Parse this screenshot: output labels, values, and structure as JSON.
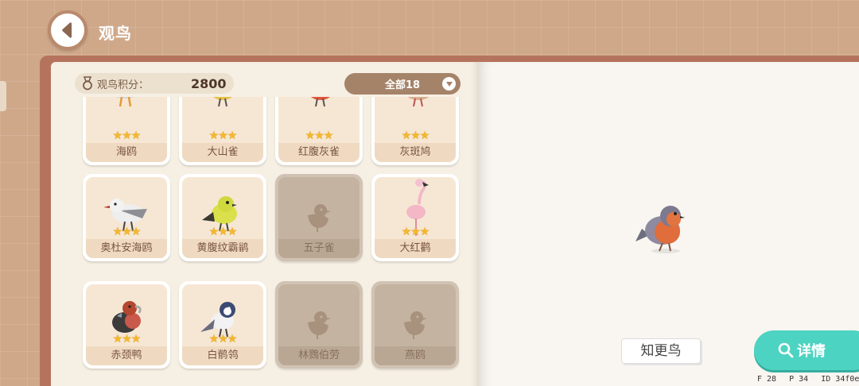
{
  "header": {
    "title": "观鸟"
  },
  "score": {
    "label": "观鸟积分：",
    "value": "2800"
  },
  "filter": {
    "label": "全部18"
  },
  "stars": "★★★",
  "birds": [
    {
      "name": "海鸥",
      "locked": false
    },
    {
      "name": "大山雀",
      "locked": false
    },
    {
      "name": "红腹灰雀",
      "locked": false
    },
    {
      "name": "灰斑鸠",
      "locked": false
    },
    {
      "name": "奥杜安海鸥",
      "locked": false
    },
    {
      "name": "黄腹纹霸鹟",
      "locked": false
    },
    {
      "name": "五子雀",
      "locked": true
    },
    {
      "name": "大红鹳",
      "locked": false
    },
    {
      "name": "赤颈鸭",
      "locked": false
    },
    {
      "name": "白鹡鸰",
      "locked": false
    },
    {
      "name": "林鷚伯劳",
      "locked": true
    },
    {
      "name": "燕鸥",
      "locked": true
    }
  ],
  "detail": {
    "learn_more": "知更鸟",
    "details_button": "详情"
  },
  "debug": {
    "f": "F 28",
    "p": "P 34",
    "id": "ID 34f0e"
  }
}
